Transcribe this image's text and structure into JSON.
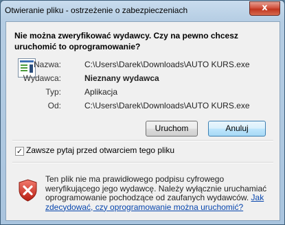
{
  "window": {
    "title": "Otwieranie pliku - ostrzeżenie o zabezpieczeniach",
    "close_glyph": "x"
  },
  "dialog": {
    "question": "Nie można zweryfikować wydawcy. Czy na pewno chcesz uruchomić to oprogramowanie?",
    "file_icon": "executable-file-icon",
    "details": [
      {
        "label": "Nazwa:",
        "value": "C:\\Users\\Darek\\Downloads\\AUTO KURS.exe"
      },
      {
        "label": "Wydawca:",
        "value": "Nieznany wydawca"
      },
      {
        "label": "Typ:",
        "value": "Aplikacja"
      },
      {
        "label": "Od:",
        "value": "C:\\Users\\Darek\\Downloads\\AUTO KURS.exe"
      }
    ],
    "buttons": {
      "run": "Uruchom",
      "cancel": "Anuluj"
    },
    "checkbox": {
      "label": "Zawsze pytaj przed otwarciem tego pliku",
      "checked": true
    },
    "warning": {
      "icon": "red-shield-x-icon",
      "text": "Ten plik nie ma prawidłowego podpisu cyfrowego weryfikującego jego wydawcę. Należy wyłącznie uruchamiać oprogramowanie pochodzące od zaufanych wydawców.",
      "link": "Jak zdecydować, czy oprogramowanie można uruchomić?"
    }
  }
}
